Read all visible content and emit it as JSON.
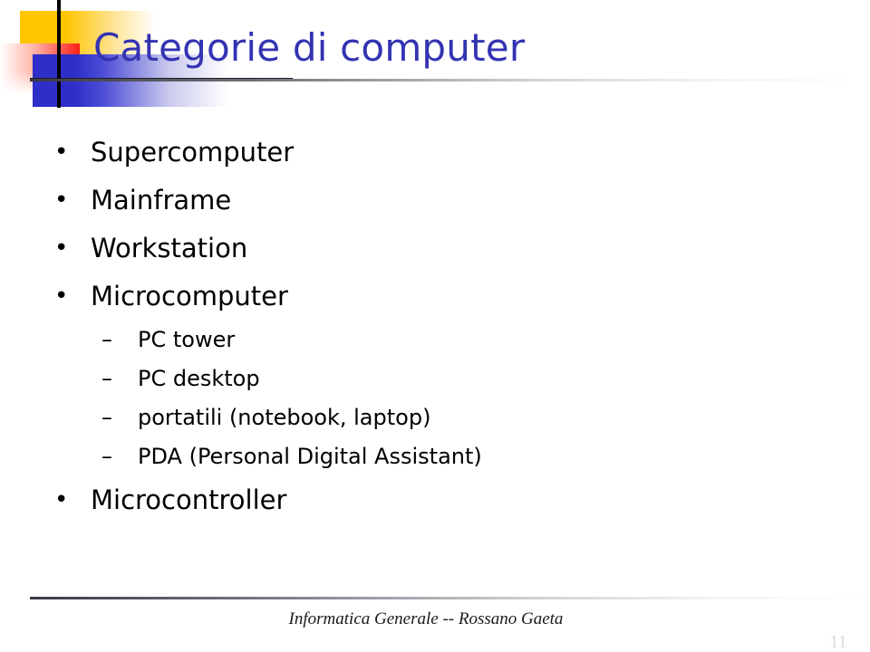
{
  "slide": {
    "title": "Categorie di computer",
    "title_color": "#3333B2",
    "background_color": "#FFFFFF",
    "body_text_color": "#000000",
    "bullets": [
      {
        "level": 1,
        "marker": "•",
        "text": "Supercomputer"
      },
      {
        "level": 1,
        "marker": "•",
        "text": "Mainframe"
      },
      {
        "level": 1,
        "marker": "•",
        "text": "Workstation"
      },
      {
        "level": 1,
        "marker": "•",
        "text": "Microcomputer"
      },
      {
        "level": 2,
        "marker": "–",
        "text": "PC tower"
      },
      {
        "level": 2,
        "marker": "–",
        "text": "PC desktop"
      },
      {
        "level": 2,
        "marker": "–",
        "text": "portatili (notebook, laptop)"
      },
      {
        "level": 2,
        "marker": "–",
        "text": "PDA (Personal Digital Assistant)"
      },
      {
        "level": 1,
        "marker": "•",
        "text": "Microcontroller"
      }
    ]
  },
  "decoration": {
    "yellow_color": "#FFC500",
    "red_color": "#FD1F18",
    "blue_color": "#2E2EC8",
    "line_color": "#000000"
  },
  "footer": {
    "text": "Informatica Generale -- Rossano Gaeta",
    "page_number": "11"
  }
}
